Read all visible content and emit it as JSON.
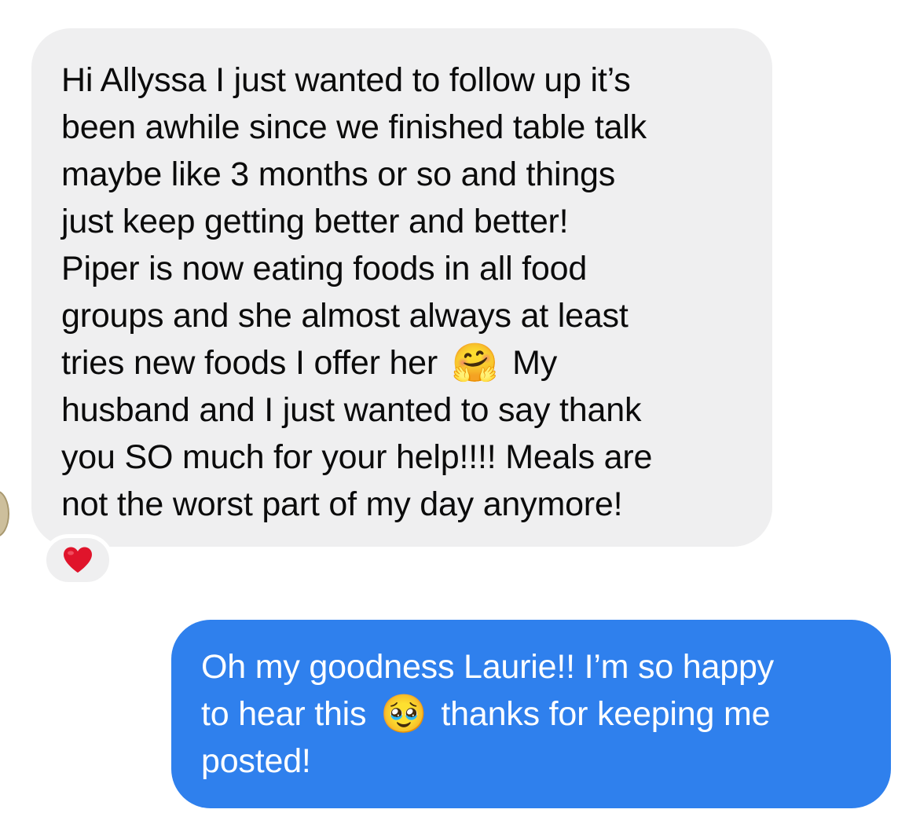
{
  "conversation": {
    "incoming_message": {
      "lines": [
        "Hi Allyssa I just wanted to follow up it’s",
        "been awhile since we finished table talk",
        "maybe like 3 months or so and things",
        "just keep getting better and better!",
        "Piper is now eating foods in all food",
        "groups and she almost always at least",
        "tries new foods I offer her",
        "My",
        "husband and I just wanted to say thank",
        "you SO much for your help!!!! Meals are",
        "not the worst part of my day anymore!"
      ],
      "emoji": "🤗",
      "reaction": "❤️",
      "reaction_icon": "heart-icon"
    },
    "outgoing_message": {
      "lines": [
        "Oh my goodness Laurie!! I’m so happy",
        "to hear this",
        "thanks for keeping me",
        "posted!"
      ],
      "emoji": "🥹"
    },
    "colors": {
      "incoming_bubble": "#efeff0",
      "outgoing_bubble": "#2f80ed",
      "reaction_heart": "#e0142b"
    }
  }
}
